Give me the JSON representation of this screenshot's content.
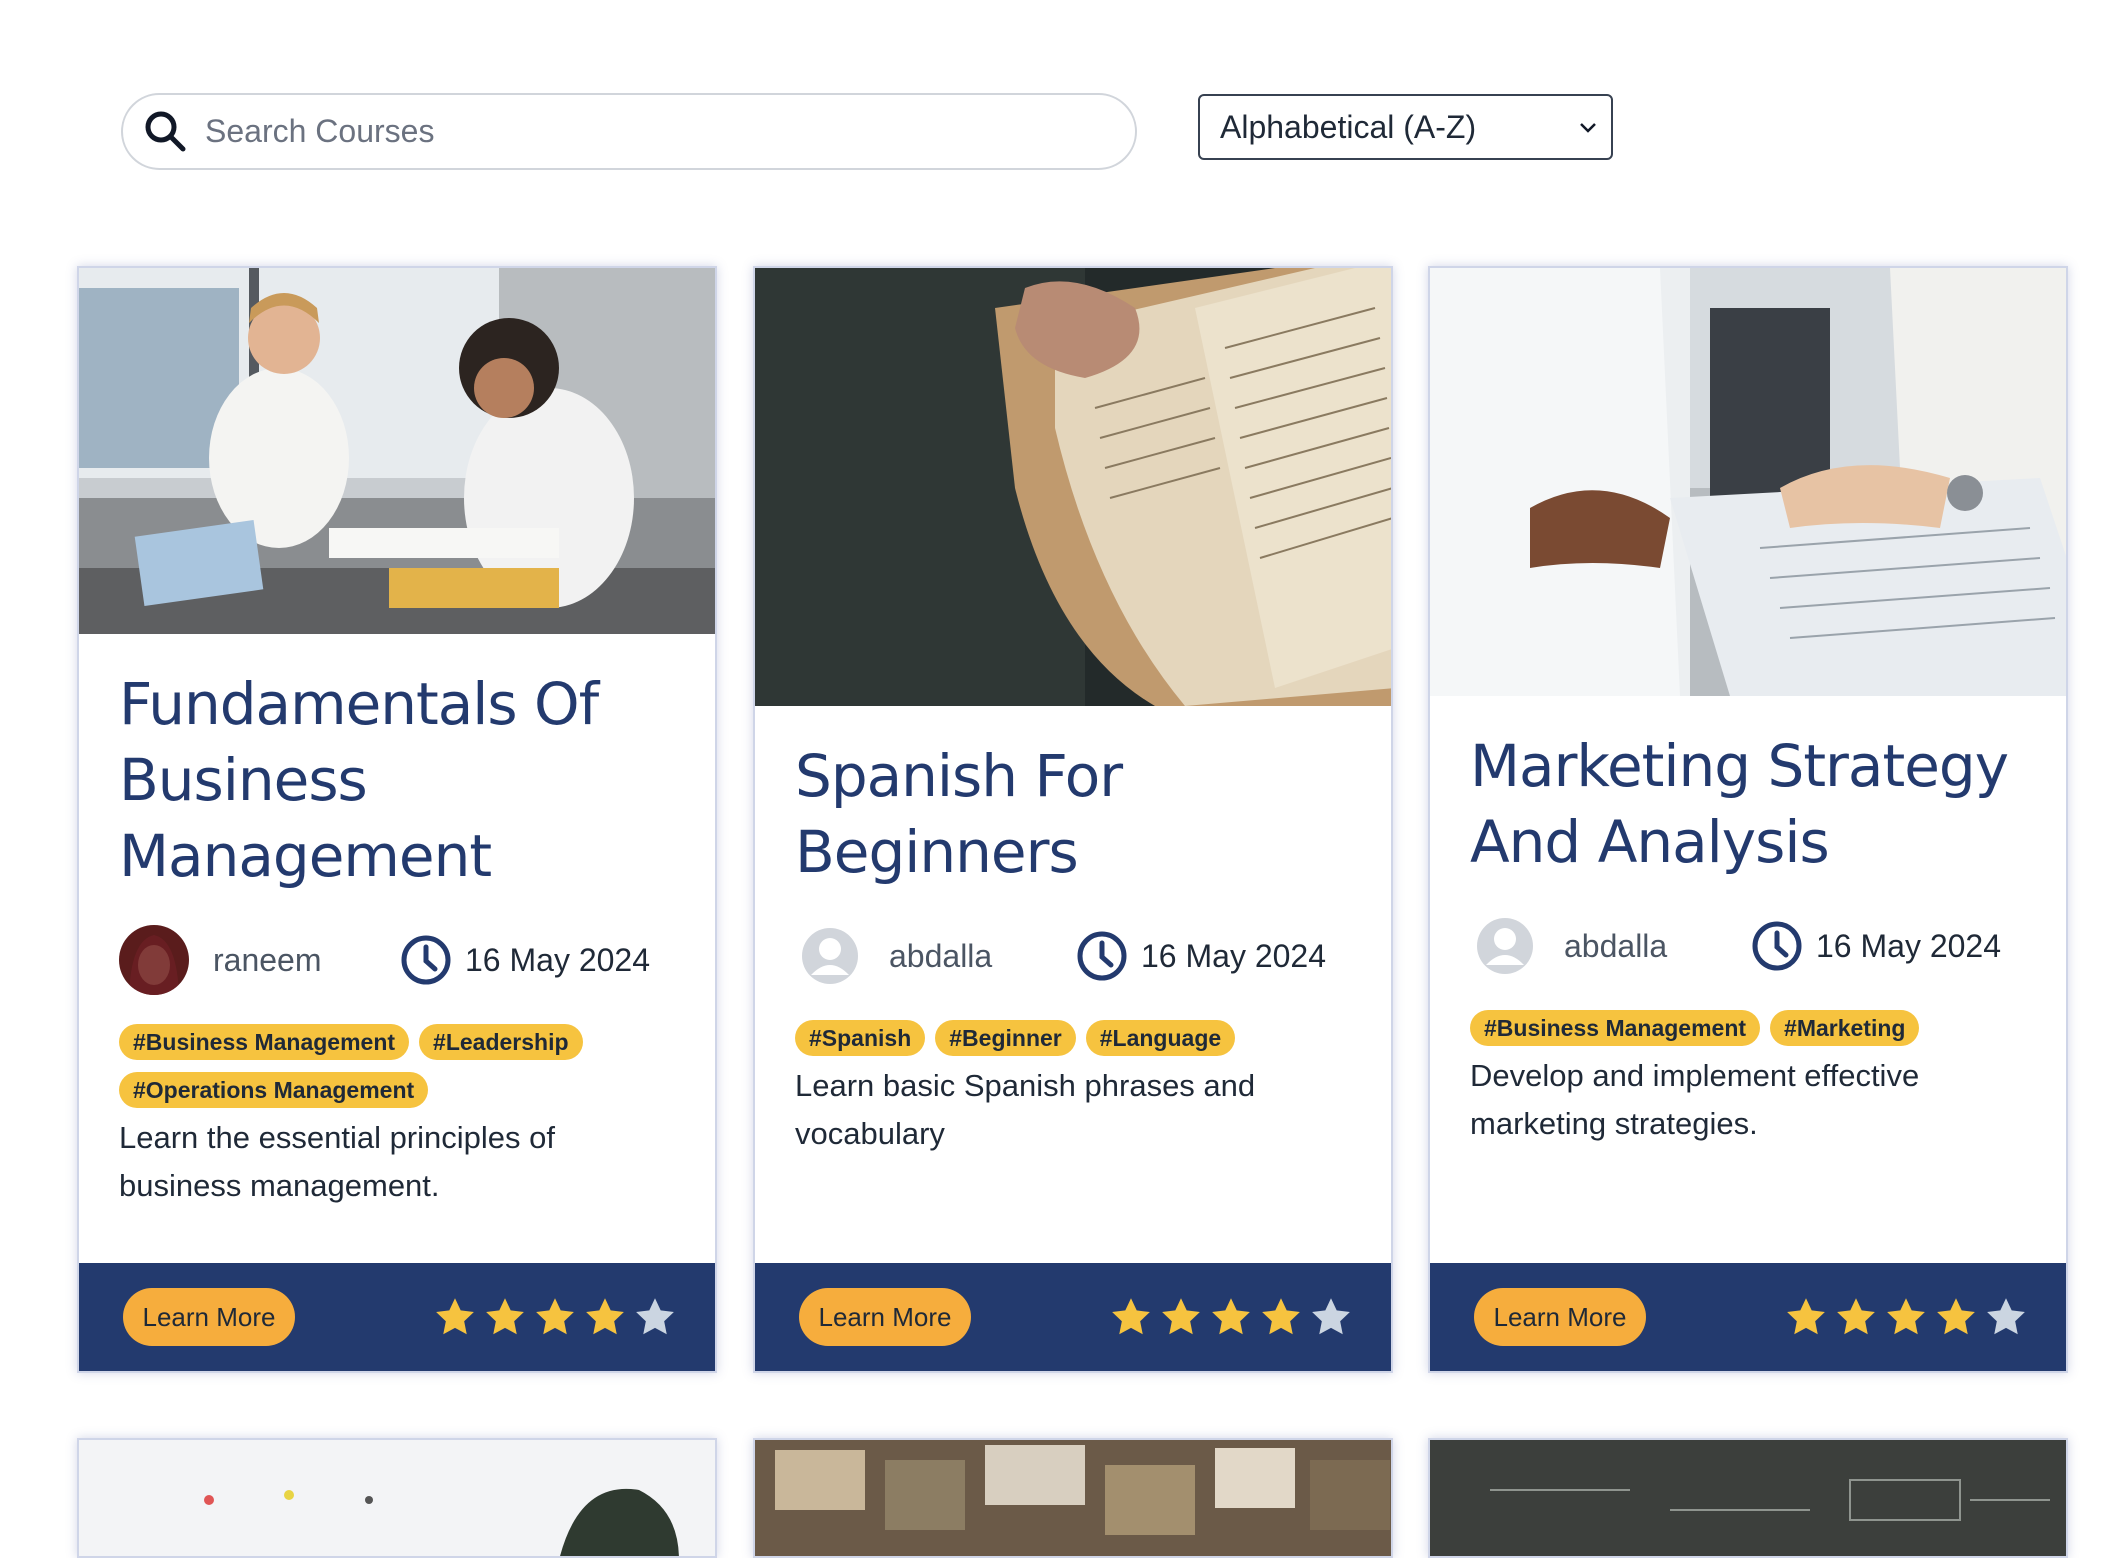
{
  "search": {
    "placeholder": "Search Courses",
    "value": ""
  },
  "sort": {
    "selected": "Alphabetical (A-Z)"
  },
  "cards": [
    {
      "title": "Fundamentals Of Business Management",
      "author": "raneem",
      "date": "16 May 2024",
      "tags": [
        "#Business Management",
        "#Leadership",
        "#Operations Management"
      ],
      "description": "Learn the essential principles of business management.",
      "button": "Learn More",
      "rating": 4,
      "rating_max": 5
    },
    {
      "title": "Spanish For Beginners",
      "author": "abdalla",
      "date": "16 May 2024",
      "tags": [
        "#Spanish",
        "#Beginner",
        "#Language"
      ],
      "description": "Learn basic Spanish phrases and vocabulary",
      "button": "Learn More",
      "rating": 4,
      "rating_max": 5
    },
    {
      "title": "Marketing Strategy And Analysis",
      "author": "abdalla",
      "date": "16 May 2024",
      "tags": [
        "#Business Management",
        "#Marketing"
      ],
      "description": "Develop and implement effective marketing strategies.",
      "button": "Learn More",
      "rating": 4,
      "rating_max": 5
    }
  ],
  "colors": {
    "navy": "#233a6e",
    "tag": "#f6c33f",
    "button": "#f6ad3d",
    "star_on": "#f6c33f",
    "star_off": "#cbd5e1"
  },
  "icons": {
    "search": "search-icon",
    "date": "clock-icon",
    "sort": "chevron-down-icon",
    "rating": "star-icon"
  }
}
